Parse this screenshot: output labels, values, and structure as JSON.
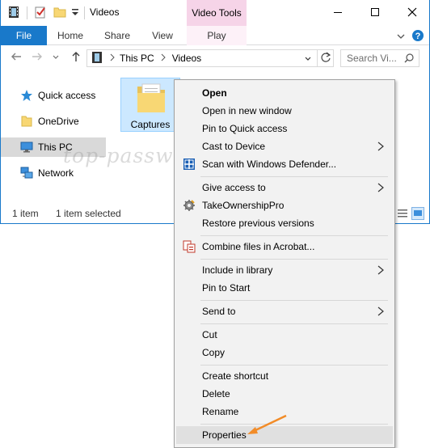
{
  "window": {
    "title": "Videos",
    "contextual_tab_group": "Video Tools",
    "accent_color": "#1979ca",
    "contextual_color": "#f6d4e8"
  },
  "ribbon": {
    "tabs": [
      "File",
      "Home",
      "Share",
      "View"
    ],
    "contextual_tab": "Play"
  },
  "address": {
    "breadcrumb": [
      "This PC",
      "Videos"
    ],
    "search_placeholder": "Search Vi..."
  },
  "nav_pane": {
    "items": [
      {
        "label": "Quick access",
        "icon": "star-icon"
      },
      {
        "label": "OneDrive",
        "icon": "folder-icon"
      },
      {
        "label": "This PC",
        "icon": "computer-icon",
        "selected": true
      },
      {
        "label": "Network",
        "icon": "network-icon"
      }
    ]
  },
  "content": {
    "items": [
      {
        "label": "Captures",
        "icon": "folder-icon",
        "selected": true
      }
    ]
  },
  "status": {
    "count": "1 item",
    "selection": "1 item selected"
  },
  "context_menu": {
    "items": [
      {
        "label": "Open",
        "bold": true
      },
      {
        "label": "Open in new window"
      },
      {
        "label": "Pin to Quick access"
      },
      {
        "label": "Cast to Device",
        "submenu": true
      },
      {
        "label": "Scan with Windows Defender...",
        "icon": "defender-icon"
      },
      {
        "label": "Give access to",
        "submenu": true
      },
      {
        "label": "TakeOwnershipPro",
        "icon": "gear-icon"
      },
      {
        "label": "Restore previous versions"
      },
      {
        "label": "Combine files in Acrobat...",
        "icon": "acrobat-icon"
      },
      {
        "label": "Include in library",
        "submenu": true
      },
      {
        "label": "Pin to Start"
      },
      {
        "label": "Send to",
        "submenu": true
      },
      {
        "label": "Cut"
      },
      {
        "label": "Copy"
      },
      {
        "label": "Create shortcut"
      },
      {
        "label": "Delete"
      },
      {
        "label": "Rename"
      },
      {
        "label": "Properties",
        "highlighted": true
      }
    ]
  },
  "watermark": "top-password.com"
}
